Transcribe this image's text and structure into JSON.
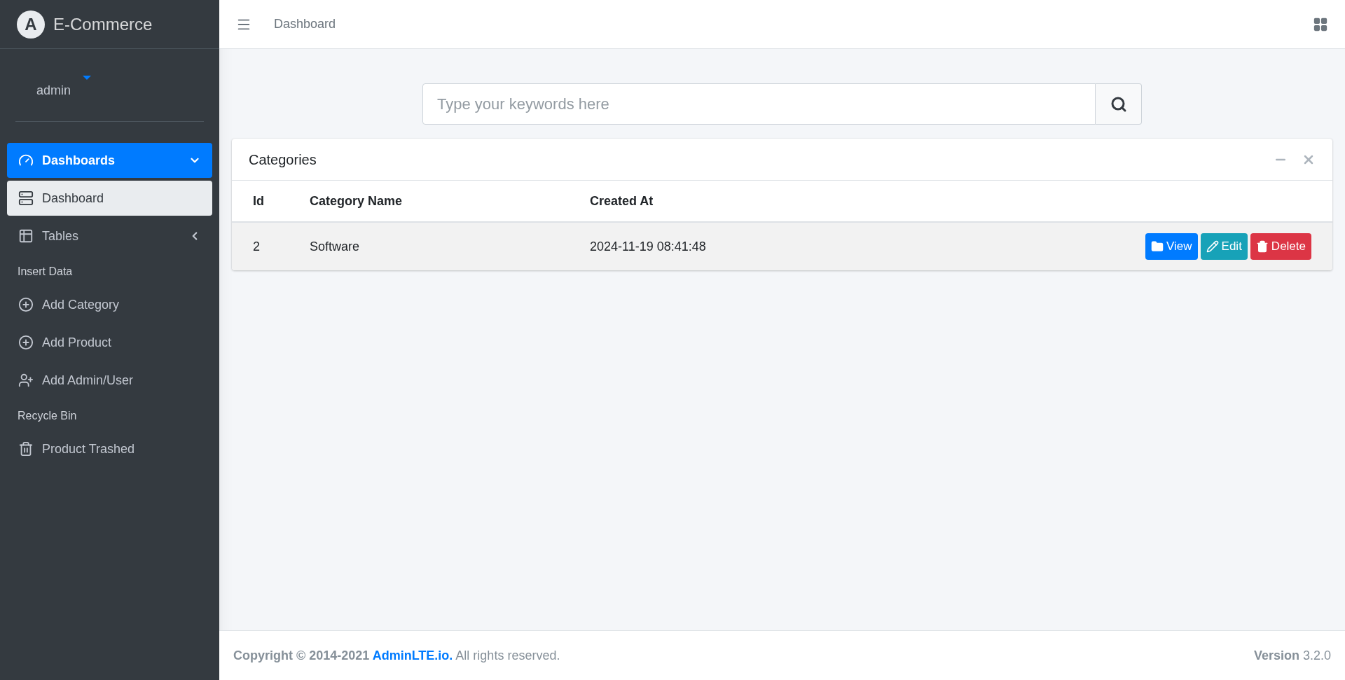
{
  "brand": {
    "name": "E-Commerce",
    "logo_letter": "A"
  },
  "user": {
    "name": "admin"
  },
  "sidebar": {
    "items": [
      {
        "kind": "item",
        "label": "Dashboards",
        "selected": true,
        "expanded": true,
        "children": [
          {
            "kind": "item",
            "label": "Dashboard",
            "selected": true
          }
        ]
      },
      {
        "kind": "item",
        "label": "Tables",
        "selected": false,
        "expanded": false
      },
      {
        "kind": "header",
        "label": "Insert Data"
      },
      {
        "kind": "item",
        "label": "Add Category",
        "selected": false
      },
      {
        "kind": "item",
        "label": "Add Product",
        "selected": false
      },
      {
        "kind": "item",
        "label": "Add Admin/User",
        "selected": false
      },
      {
        "kind": "header",
        "label": "Recycle Bin"
      },
      {
        "kind": "item",
        "label": "Product Trashed",
        "selected": false
      }
    ]
  },
  "topbar": {
    "breadcrumb": "Dashboard"
  },
  "search": {
    "placeholder": "Type your keywords here"
  },
  "card": {
    "title": "Categories",
    "table": {
      "columns": [
        "Id",
        "Category Name",
        "Created At"
      ],
      "rows": [
        {
          "cells": [
            "2",
            "Software",
            "2024-11-19 08:41:48"
          ],
          "actions": [
            {
              "kind": "view",
              "label": "View"
            },
            {
              "kind": "edit",
              "label": "Edit"
            },
            {
              "kind": "delete",
              "label": "Delete"
            }
          ]
        }
      ]
    }
  },
  "footer": {
    "copyright": "Copyright © 2014-2021",
    "link": "AdminLTE.io.",
    "rights": "All rights reserved.",
    "version_label": "Version",
    "version": "3.2.0"
  }
}
